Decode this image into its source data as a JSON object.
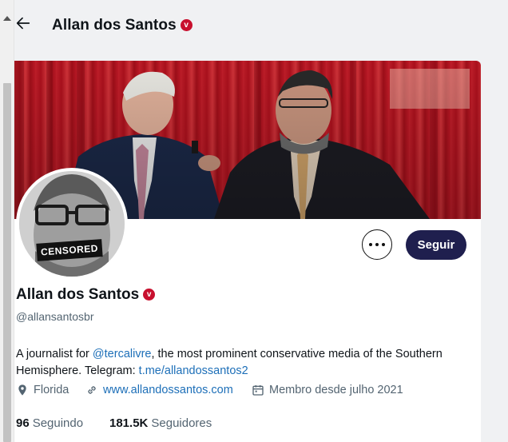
{
  "header": {
    "back_icon": "arrow-left-icon",
    "title": "Allan dos Santos",
    "badge": "v"
  },
  "profile": {
    "name": "Allan dos Santos",
    "badge": "v",
    "handle": "@allansantosbr",
    "avatar_overlay_text": "CENSORED",
    "follow_label": "Seguir",
    "more_icon": "more-horizontal-icon",
    "bio": {
      "part1": "A journalist for ",
      "mention": "@tercalivre",
      "part2": ", the most prominent conservative media of the Southern Hemisphere. Telegram: ",
      "telegram_link": "t.me/allandossantos2"
    },
    "location": "Florida",
    "website": "www.allandossantos.com",
    "joined": "Membro desde julho 2021",
    "following_count": "96",
    "following_label": "Seguindo",
    "followers_count": "181.5K",
    "followers_label": "Seguidores"
  },
  "colors": {
    "follow_button": "#1f1f4e",
    "link": "#1d6fb8",
    "badge": "#c8102e",
    "banner_curtain": "#c41a27"
  }
}
